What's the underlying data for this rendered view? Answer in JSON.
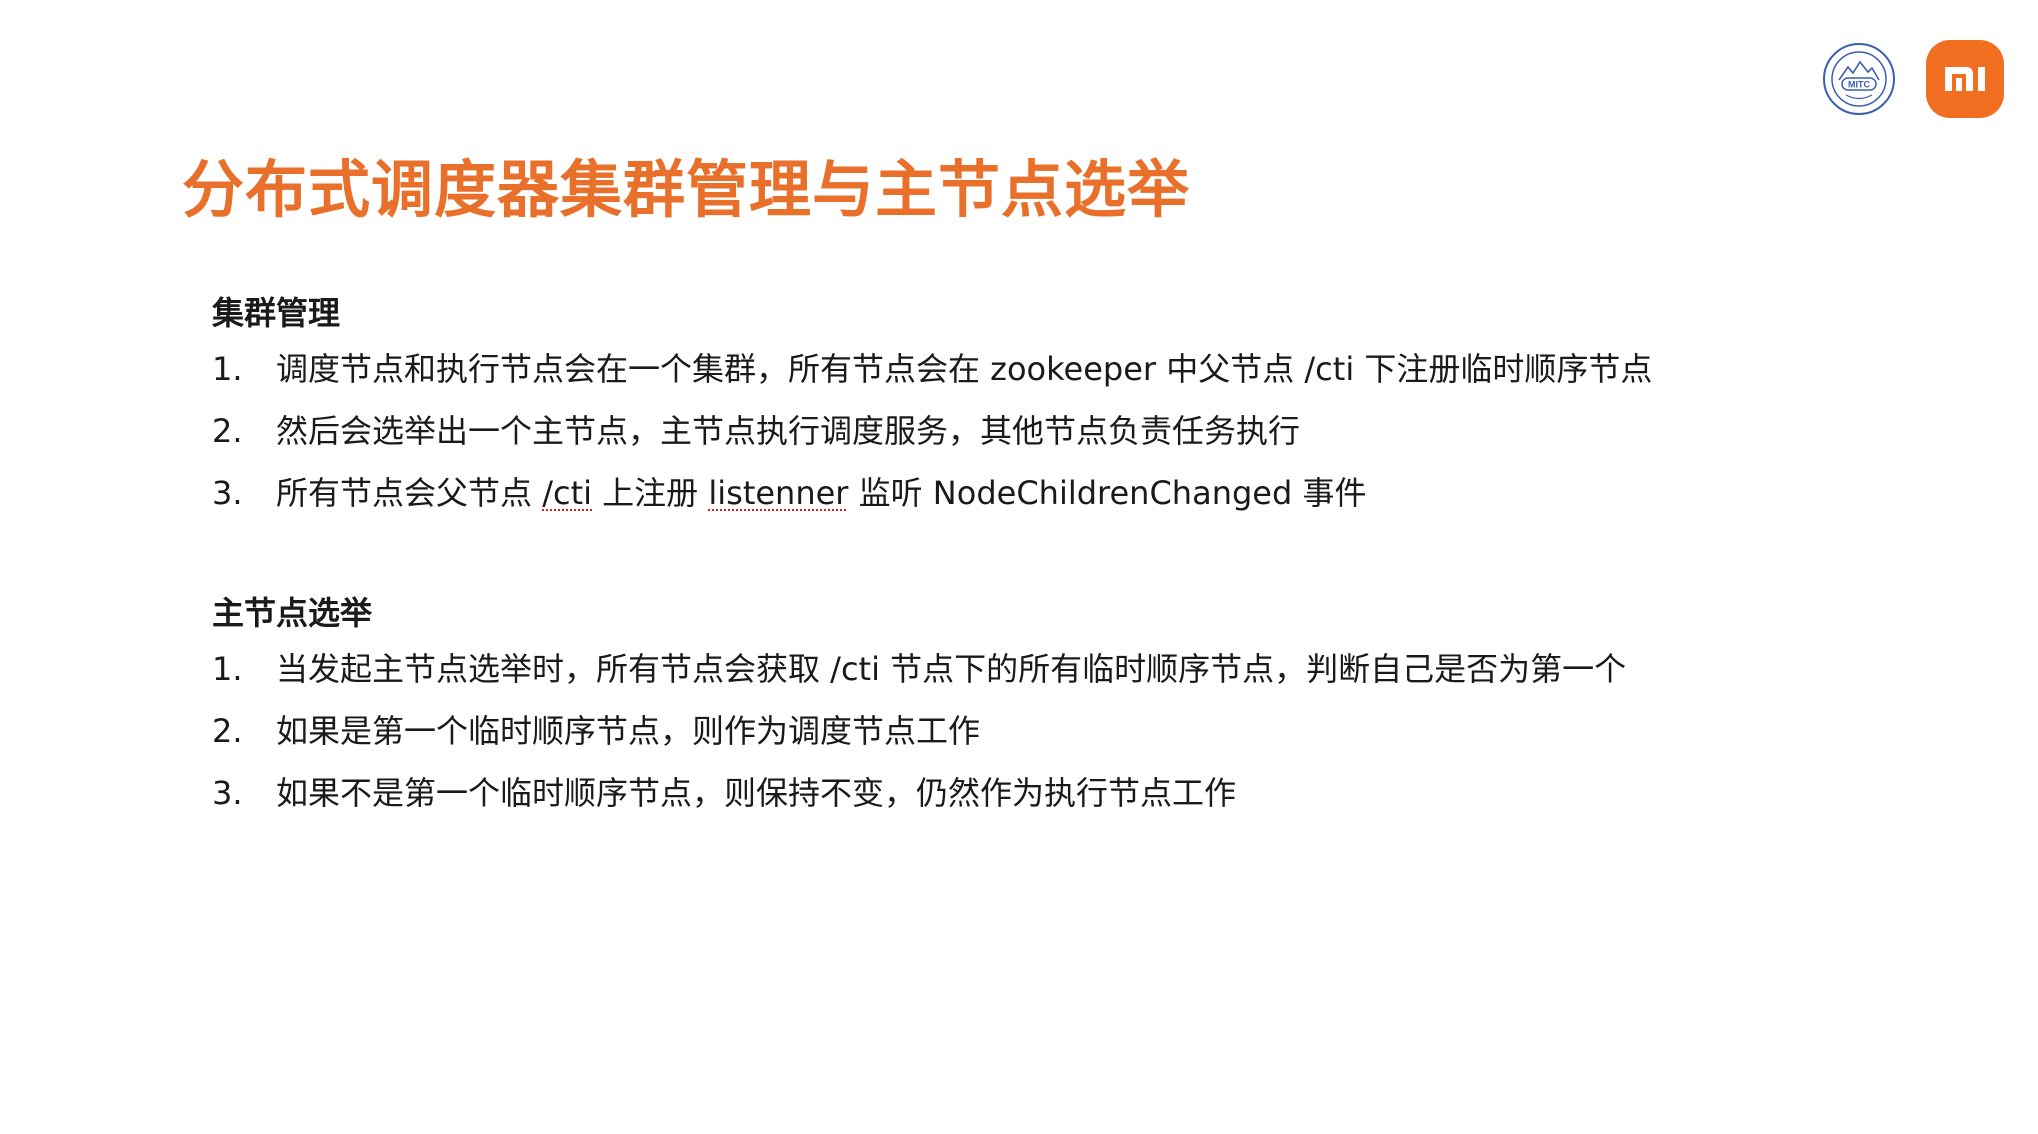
{
  "slide": {
    "title": "分布式调度器集群管理与主节点选举"
  },
  "logos": {
    "mitc": {
      "icon": "mitc-seal-icon",
      "text": "MITC",
      "color": "#3b5fae"
    },
    "mi": {
      "icon": "mi-logo-icon",
      "color": "#f26f21"
    }
  },
  "sections": [
    {
      "heading": "集群管理",
      "items": [
        {
          "num": "1.",
          "text": "调度节点和执行节点会在一个集群，所有节点会在 zookeeper 中父节点 /cti 下注册临时顺序节点"
        },
        {
          "num": "2.",
          "text": "然后会选举出一个主节点，主节点执行调度服务，其他节点负责任务执行"
        },
        {
          "num": "3.",
          "pre": "所有节点会父节点 ",
          "w1": "/cti",
          "mid": " 上注册 ",
          "w2": "listenner",
          "post": " 监听 NodeChildrenChanged 事件"
        }
      ]
    },
    {
      "heading": "主节点选举",
      "items": [
        {
          "num": "1.",
          "text": "当发起主节点选举时，所有节点会获取 /cti 节点下的所有临时顺序节点，判断自己是否为第一个"
        },
        {
          "num": "2.",
          "text": "如果是第一个临时顺序节点，则作为调度节点工作"
        },
        {
          "num": "3.",
          "text": "如果不是第一个临时顺序节点，则保持不变，仍然作为执行节点工作"
        }
      ]
    }
  ],
  "colors": {
    "title": "#e8702a",
    "text": "#1a1a1a",
    "spellcheck_underline": "#e02020"
  }
}
